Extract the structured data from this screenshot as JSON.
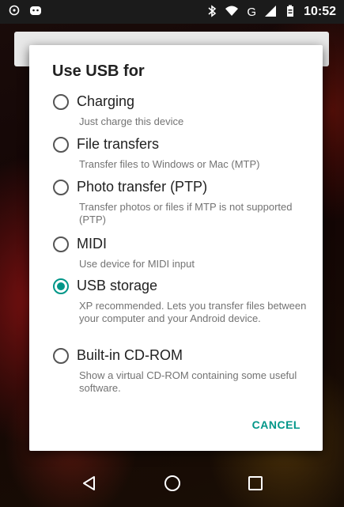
{
  "status_bar": {
    "time": "10:52",
    "left_icons": [
      "circle-sync-icon",
      "android-notification-icon"
    ],
    "right_icons": [
      "bluetooth-icon",
      "wifi-icon",
      "cellular-signal-icon",
      "battery-icon"
    ],
    "network_type": "G"
  },
  "dialog": {
    "title": "Use USB for",
    "options": [
      {
        "label": "Charging",
        "description": "Just charge this device",
        "selected": false
      },
      {
        "label": "File transfers",
        "description": "Transfer files to Windows or Mac (MTP)",
        "selected": false
      },
      {
        "label": "Photo transfer (PTP)",
        "description": "Transfer photos or files if MTP is not supported (PTP)",
        "selected": false
      },
      {
        "label": "MIDI",
        "description": "Use device for MIDI input",
        "selected": false
      },
      {
        "label": "USB storage",
        "description": "XP recommended. Lets you transfer files between your computer and your Android device.",
        "selected": true
      },
      {
        "label": "Built-in CD-ROM",
        "description": "Show a virtual CD-ROM containing some useful software.",
        "selected": false
      }
    ],
    "cancel_label": "CANCEL"
  },
  "nav_bar": {
    "icons": [
      "back-icon",
      "home-icon",
      "recents-icon"
    ]
  },
  "colors": {
    "accent": "#009688",
    "title_text": "#212121",
    "description_text": "#737373"
  }
}
